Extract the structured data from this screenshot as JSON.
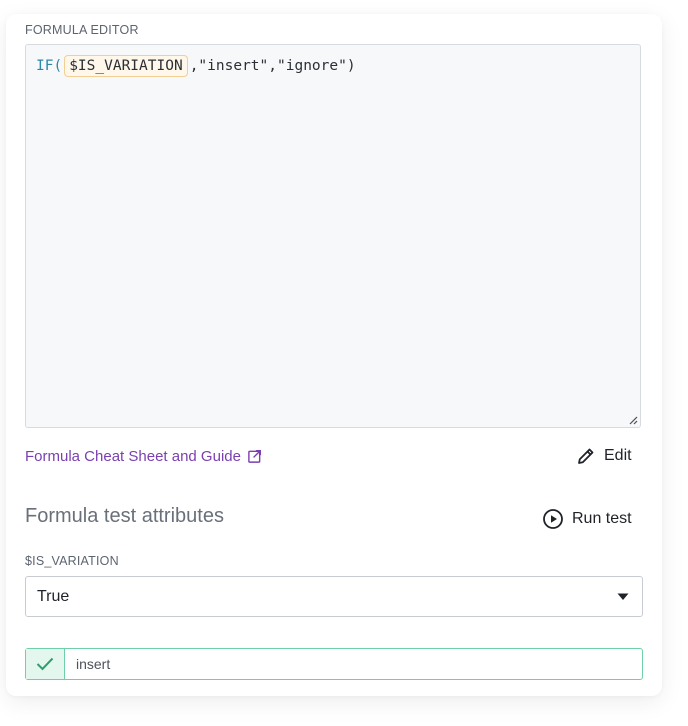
{
  "editor": {
    "label": "FORMULA EDITOR",
    "formula": {
      "fn": "IF(",
      "variable": "$IS_VARIATION",
      "rest": ",\"insert\",\"ignore\")"
    }
  },
  "links": {
    "cheat_sheet": "Formula Cheat Sheet and Guide"
  },
  "actions": {
    "edit_label": "Edit",
    "run_test_label": "Run test"
  },
  "test_section": {
    "title": "Formula test attributes",
    "attribute_label": "$IS_VARIATION",
    "selected_value": "True"
  },
  "result": {
    "value": "insert"
  },
  "colors": {
    "link": "#7b3fb0",
    "success": "#6fcfa8",
    "variable_highlight": "#f2cf95"
  },
  "icons": {
    "external": "external-link-icon",
    "edit": "pencil-icon",
    "run": "play-circle-icon",
    "dropdown": "caret-down-icon",
    "success": "checkmark-icon",
    "resize": "resize-handle-icon"
  }
}
